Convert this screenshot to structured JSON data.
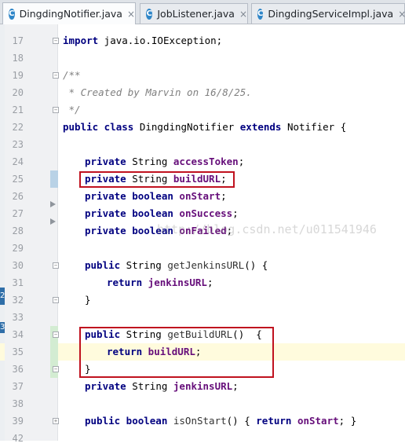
{
  "tabs": [
    {
      "label": "DingdingNotifier.java",
      "icon": "class-c-icon",
      "active": true
    },
    {
      "label": "JobListener.java",
      "icon": "class-c-icon",
      "active": false
    },
    {
      "label": "DingdingServiceImpl.java",
      "icon": "class-c-icon",
      "active": false
    }
  ],
  "icons": {
    "class": "C",
    "close": "×",
    "fold_minus": "−",
    "fold_plus": "+"
  },
  "line_numbers": [
    "17",
    "18",
    "19",
    "20",
    "21",
    "22",
    "23",
    "24",
    "25",
    "26",
    "27",
    "28",
    "29",
    "30",
    "31",
    "32",
    "33",
    "34",
    "35",
    "36",
    "37",
    "38",
    "39",
    "42"
  ],
  "code": {
    "l17_kw": "import",
    "l17_rest": " java.io.IOException;",
    "l19": "/**",
    "l20": " * Created by Marvin on 16/8/25.",
    "l21": " */",
    "l22_kw1": "public class",
    "l22_name": " DingdingNotifier ",
    "l22_kw2": "extends",
    "l22_rest": " Notifier {",
    "l24_kw": "private",
    "l24_type": " String ",
    "l24_field": "accessToken",
    "l24_end": ";",
    "l25_kw": "private",
    "l25_type": " String ",
    "l25_field": "buildURL",
    "l25_end": ";",
    "l26_kw": "private boolean",
    "l26_field": " onStart",
    "l26_end": ";",
    "l27_kw": "private boolean",
    "l27_field": " onSuccess",
    "l27_end": ";",
    "l28_kw": "private boolean",
    "l28_field": " onFailed",
    "l28_end": ";",
    "l30_kw": "public",
    "l30_type": " String ",
    "l30_method": "getJenkinsURL",
    "l30_end": "() {",
    "l31_kw": "return",
    "l31_field": " jenkinsURL",
    "l31_end": ";",
    "l32": "}",
    "l34_kw": "public",
    "l34_type": " String ",
    "l34_method": "getBuildURL",
    "l34_end": "()  {",
    "l35_kw": "return",
    "l35_field": " buildURL",
    "l35_end": ";",
    "l36": "}",
    "l37_kw": "private",
    "l37_type": " String ",
    "l37_field": "jenkinsURL",
    "l37_end": ";",
    "l39_kw1": "public boolean",
    "l39_method": " isOnStart",
    "l39_mid": "() { ",
    "l39_kw2": "return",
    "l39_field": " onStart",
    "l39_end": "; }"
  },
  "watermark": "http://blog.csdn.net/u011541946",
  "side_marks": [
    "2",
    "3"
  ],
  "colors": {
    "keyword": "#000080",
    "field": "#660e7a",
    "comment": "#808080",
    "highlight_box": "#c0121f",
    "current_line": "#fffbdd",
    "selection_gutter": "#d3ecd2"
  }
}
